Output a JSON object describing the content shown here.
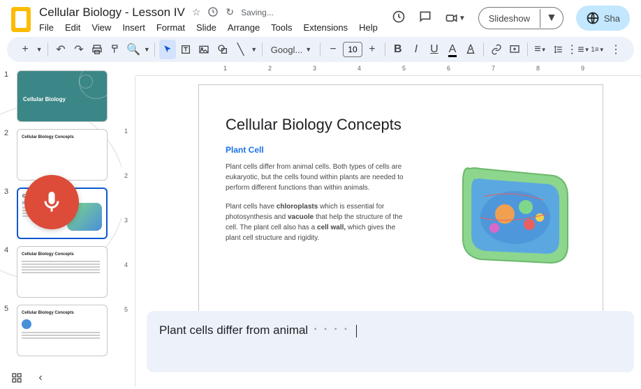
{
  "header": {
    "title": "Cellular Biology - Lesson IV",
    "saving": "Saving...",
    "slideshow": "Slideshow",
    "share": "Sha"
  },
  "menu": [
    "File",
    "Edit",
    "View",
    "Insert",
    "Format",
    "Slide",
    "Arrange",
    "Tools",
    "Extensions",
    "Help"
  ],
  "toolbar": {
    "font": "Googl...",
    "size": "10"
  },
  "ruler_h": [
    "1",
    "2",
    "3",
    "4",
    "5",
    "6",
    "7",
    "8",
    "9"
  ],
  "ruler_v": [
    "1",
    "2",
    "3",
    "4",
    "5"
  ],
  "thumbs": [
    {
      "num": "1",
      "title": "Cellular Biology"
    },
    {
      "num": "2",
      "title": "Cellular Biology Concepts"
    },
    {
      "num": "3",
      "title": "Cellular Biology Concepts"
    },
    {
      "num": "4",
      "title": "Cellular Biology Concepts"
    },
    {
      "num": "5",
      "title": "Cellular Biology Concepts"
    }
  ],
  "slide": {
    "title": "Cellular Biology Concepts",
    "subhead": "Plant Cell",
    "p1": "Plant cells differ from animal cells. Both types of cells are eukaryotic, but the cells found within plants are needed to perform different functions than within animals.",
    "p2_a": "Plant cells have ",
    "p2_b": "chloroplasts",
    "p2_c": " which is essential for photosynthesis and ",
    "p2_d": "vacuole",
    "p2_e": " that help the structure of the cell. The plant cell also has a ",
    "p2_f": "cell wall,",
    "p2_g": " which gives the plant cell structure and rigidity."
  },
  "caption": "Plant cells differ from animal"
}
